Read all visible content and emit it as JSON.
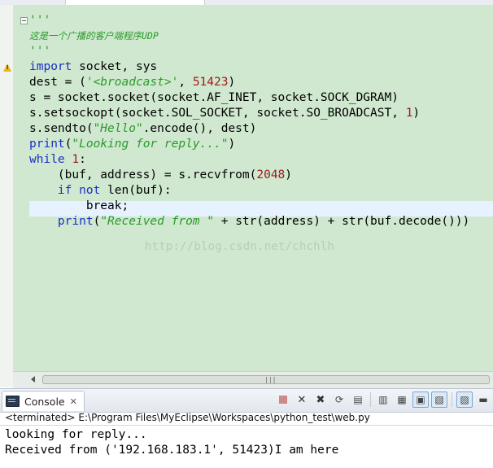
{
  "editor": {
    "code_lines": [
      [
        {
          "t": "'''",
          "c": "doc"
        }
      ],
      [
        {
          "t": "这是一个广播的客户端程序UDP",
          "c": "cn"
        }
      ],
      [
        {
          "t": "'''",
          "c": "doc"
        }
      ],
      [
        {
          "t": "import",
          "c": "kw"
        },
        {
          "t": " socket, sys",
          "c": ""
        }
      ],
      [
        {
          "t": "dest = (",
          "c": ""
        },
        {
          "t": "'<broadcast>'",
          "c": "str"
        },
        {
          "t": ", ",
          "c": ""
        },
        {
          "t": "51423",
          "c": "num"
        },
        {
          "t": ")",
          "c": ""
        }
      ],
      [
        {
          "t": "s = socket.socket(socket.AF_INET, socket.SOCK_DGRAM)",
          "c": ""
        }
      ],
      [
        {
          "t": "s.setsockopt(socket.SOL_SOCKET, socket.SO_BROADCAST, ",
          "c": ""
        },
        {
          "t": "1",
          "c": "num"
        },
        {
          "t": ")",
          "c": ""
        }
      ],
      [
        {
          "t": "s.sendto(",
          "c": ""
        },
        {
          "t": "\"Hello\"",
          "c": "str"
        },
        {
          "t": ".encode(), dest)",
          "c": ""
        }
      ],
      [
        {
          "t": "print",
          "c": "kw"
        },
        {
          "t": "(",
          "c": ""
        },
        {
          "t": "\"Looking for reply...\"",
          "c": "str"
        },
        {
          "t": ")",
          "c": ""
        }
      ],
      [
        {
          "t": "while",
          "c": "kw"
        },
        {
          "t": " ",
          "c": ""
        },
        {
          "t": "1",
          "c": "num"
        },
        {
          "t": ":",
          "c": ""
        }
      ],
      [
        {
          "t": "    (buf, address) = s.recvfrom(",
          "c": ""
        },
        {
          "t": "2048",
          "c": "num"
        },
        {
          "t": ")",
          "c": ""
        }
      ],
      [
        {
          "t": "    ",
          "c": ""
        },
        {
          "t": "if",
          "c": "kw"
        },
        {
          "t": " ",
          "c": ""
        },
        {
          "t": "not",
          "c": "kw"
        },
        {
          "t": " len(buf):",
          "c": ""
        }
      ],
      [
        {
          "t": "        break;",
          "c": ""
        }
      ],
      [
        {
          "t": "    ",
          "c": ""
        },
        {
          "t": "print",
          "c": "kw"
        },
        {
          "t": "(",
          "c": ""
        },
        {
          "t": "\"Received from \"",
          "c": "str"
        },
        {
          "t": " + str(address) + str(buf.decode()))",
          "c": ""
        }
      ]
    ],
    "watermark": "http://blog.csdn.net/chchlh"
  },
  "console": {
    "tab_label": "Console",
    "path_text": "<terminated> E:\\Program Files\\MyEclipse\\Workspaces\\python_test\\web.py",
    "output_lines": [
      "looking for reply...",
      "Received from ('192.168.183.1', 51423)I am here"
    ],
    "toolbar": [
      {
        "name": "terminate-button",
        "icon": "stop-icon"
      },
      {
        "name": "remove-launch-button",
        "icon": "remove-icon"
      },
      {
        "name": "remove-all-terminated-button",
        "icon": "remove-all-icon"
      },
      {
        "name": "relaunch-button",
        "icon": "relaunch-icon"
      },
      {
        "name": "clear-console-button",
        "icon": "clear-icon"
      },
      {
        "name": "scroll-lock-button",
        "icon": "scroll-lock-icon"
      },
      {
        "name": "word-wrap-button",
        "icon": "word-wrap-icon"
      },
      {
        "name": "pin-console-button",
        "icon": "pin-icon"
      },
      {
        "name": "display-selected-console-button",
        "icon": "display-console-icon"
      },
      {
        "name": "open-console-button",
        "icon": "open-console-icon"
      },
      {
        "name": "minimize-button",
        "icon": "minimize-icon"
      }
    ]
  }
}
